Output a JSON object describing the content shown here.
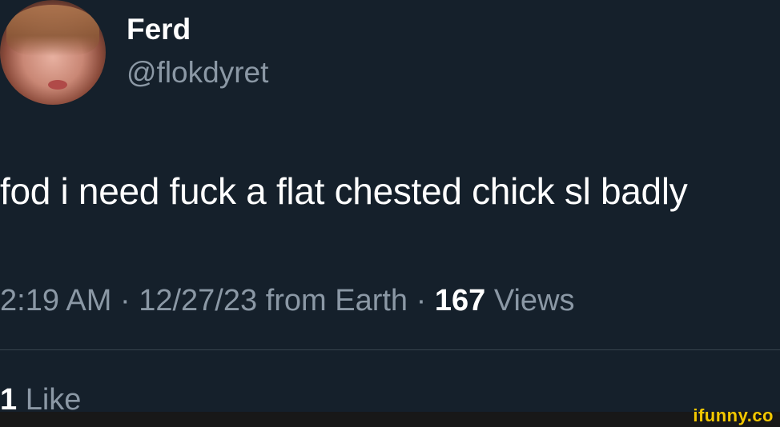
{
  "author": {
    "display_name": "Ferd",
    "handle": "@flokdyret"
  },
  "tweet": {
    "text": "fod i need fuck a flat chested chick sl badly"
  },
  "meta": {
    "time": "2:19 AM",
    "separator": "·",
    "date": "12/27/23",
    "source": "from Earth",
    "views_count": "167",
    "views_label": "Views"
  },
  "engagement": {
    "likes_count": "1",
    "likes_label": "Like"
  },
  "watermark": {
    "text": "ifunny.co"
  },
  "colors": {
    "background": "#15202b",
    "primary_text": "#ffffff",
    "secondary_text": "#8b98a5",
    "divider": "#38444d",
    "watermark": "#f3c800"
  }
}
